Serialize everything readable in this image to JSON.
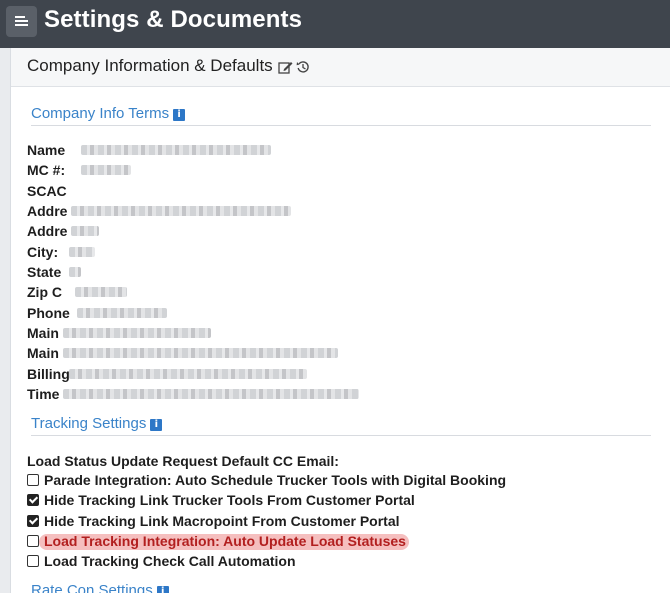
{
  "header": {
    "title": "Settings & Documents",
    "menu_icon": "hamburger-menu-icon"
  },
  "panel": {
    "title": "Company Information & Defaults",
    "icons": [
      "edit-icon",
      "history-icon"
    ]
  },
  "company_info": {
    "section_title": "Company Info Terms",
    "fields": [
      "Name",
      "MC #:",
      "SCAC",
      "Addre",
      "Addre",
      "City:",
      "State",
      "Zip C",
      "Phone",
      "Main",
      "Main",
      "Billing",
      "Time"
    ]
  },
  "tracking": {
    "section_title": "Tracking Settings",
    "cc_label": "Load Status Update Request Default CC Email:",
    "options": [
      {
        "label": "Parade Integration: Auto Schedule Trucker Tools with Digital Booking",
        "checked": false
      },
      {
        "label": "Hide Tracking Link Trucker Tools From Customer Portal",
        "checked": true
      },
      {
        "label": "Hide Tracking Link Macropoint From Customer Portal",
        "checked": true
      },
      {
        "label": "Load Tracking Integration: Auto Update Load Statuses",
        "checked": false,
        "highlighted": true
      },
      {
        "label": "Load Tracking Check Call Automation",
        "checked": false
      }
    ]
  },
  "rate_con": {
    "section_title": "Rate Con Settings"
  },
  "colors": {
    "topbar": "#3f454d",
    "section_title": "#3a83c9",
    "highlight": "#f4b8b8",
    "info_icon": "#2d77c7"
  }
}
